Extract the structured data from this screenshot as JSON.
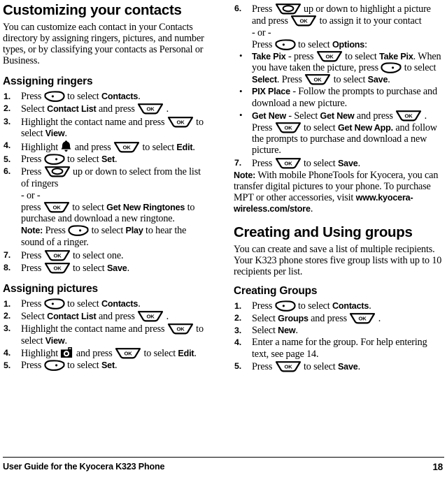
{
  "document": {
    "footer_text": "User Guide for the Kyocera K323 Phone",
    "page_number": "18"
  },
  "icons": {
    "left_softkey": "left-softkey-icon",
    "right_softkey": "right-softkey-icon",
    "ok_key": "ok-key-icon",
    "ok_key_label": "OK",
    "navigation_key": "navigation-key-icon",
    "bell": "bell-icon",
    "camera": "camera-icon"
  },
  "left_column": {
    "title": "Customizing your contacts",
    "intro": "You can customize each contact in your Contacts directory by assigning ringers, pictures, and number types, or by classifying your contacts as Personal or Business.",
    "section_ringers": {
      "heading": "Assigning ringers",
      "steps": [
        {
          "num": "1.",
          "parts": [
            "Press ",
            "[LSK]",
            " to select ",
            "Contacts",
            "."
          ]
        },
        {
          "num": "2.",
          "parts": [
            "Select ",
            "Contact List",
            " and press ",
            "[OK]",
            " ."
          ]
        },
        {
          "num": "3.",
          "parts": [
            "Highlight the contact name and press ",
            "[OK]",
            " to select ",
            "View",
            "."
          ]
        },
        {
          "num": "4.",
          "parts": [
            "Highlight ",
            "[BELL]",
            " and press ",
            "[OK]",
            " to select ",
            "Edit",
            "."
          ]
        },
        {
          "num": "5.",
          "parts": [
            "Press ",
            "[RSK]",
            " to select ",
            "Set",
            "."
          ]
        },
        {
          "num": "6.",
          "parts": [
            "Press ",
            "[NAV]",
            " up or down to select from the list of ringers"
          ]
        }
      ],
      "step6_or": "- or -",
      "step6_alt": [
        "press ",
        "[OK]",
        " to select ",
        "Get New Ringtones",
        " to purchase and download a new ringtone."
      ],
      "note": {
        "label": "Note:",
        "parts": [
          "  Press ",
          "[RSK]",
          " to select ",
          "Play",
          " to hear the sound of a ringer."
        ]
      },
      "steps_cont": [
        {
          "num": "7.",
          "parts": [
            "Press ",
            "[OK]",
            " to select one."
          ]
        },
        {
          "num": "8.",
          "parts": [
            "Press ",
            "[OK]",
            " to select ",
            "Save",
            "."
          ]
        }
      ]
    },
    "section_pictures": {
      "heading": "Assigning pictures",
      "steps": [
        {
          "num": "1.",
          "parts": [
            "Press ",
            "[LSK]",
            " to select ",
            "Contacts",
            "."
          ]
        },
        {
          "num": "2.",
          "parts": [
            "Select ",
            "Contact List",
            " and press ",
            "[OK]",
            " ."
          ]
        },
        {
          "num": "3.",
          "parts": [
            "Highlight the contact name and press ",
            "[OK]",
            " to select ",
            "View",
            "."
          ]
        },
        {
          "num": "4.",
          "parts": [
            "Highlight ",
            "[CAM]",
            " and press ",
            "[OK]",
            " to select ",
            "Edit",
            "."
          ]
        },
        {
          "num": "5.",
          "parts": [
            "Press ",
            "[RSK]",
            " to select ",
            "Set",
            "."
          ]
        }
      ]
    }
  },
  "right_column": {
    "step6": {
      "num": "6.",
      "line1": [
        "Press ",
        "[NAV]",
        " up or down to highlight a picture and press ",
        "[OK]",
        " to assign it to your contact"
      ],
      "or": "- or -",
      "line2": [
        "Press ",
        "[LSK]",
        " to select ",
        "Options",
        ":"
      ]
    },
    "bullets": [
      {
        "bullet": "•",
        "term": "Take Pix",
        "parts": [
          " - press ",
          "[OK]",
          " to select ",
          "Take Pix",
          ". When you have taken the picture, press ",
          "[RSK]",
          " to select ",
          "Select",
          ". Press ",
          "[OK]",
          " to select ",
          "Save",
          "."
        ]
      },
      {
        "bullet": "•",
        "term": "PIX Place",
        "parts": [
          " - Follow the prompts to purchase and download a new picture."
        ]
      },
      {
        "bullet": "•",
        "term": "Get New",
        "parts": [
          " - Select ",
          "Get New",
          " and press ",
          "[OK]",
          " . Press ",
          "[OK]",
          " to select ",
          "Get New App.",
          " and follow the prompts to purchase and download a new picture."
        ]
      }
    ],
    "step7": {
      "num": "7.",
      "parts": [
        "Press ",
        "[OK]",
        " to select ",
        "Save",
        "."
      ]
    },
    "note": {
      "label": "Note:",
      "text_before": "  With mobile PhoneTools for Kyocera, you can transfer digital pictures to your phone. To purchase MPT or other accessories, visit ",
      "url": "www.kyocera-wireless.com/store",
      "text_after": "."
    },
    "section_groups": {
      "heading": "Creating and Using groups",
      "intro": "You can create and save a list of multiple recipients. Your K323 phone stores five group lists with up to 10 recipients per list.",
      "sub_heading": "Creating Groups",
      "steps": [
        {
          "num": "1.",
          "parts": [
            "Press ",
            "[LSK]",
            " to select ",
            "Contacts",
            "."
          ]
        },
        {
          "num": "2.",
          "parts": [
            "Select ",
            "Groups",
            " and press ",
            "[OK]",
            " ."
          ]
        },
        {
          "num": "3.",
          "parts": [
            "Select ",
            "New",
            "."
          ]
        },
        {
          "num": "4.",
          "parts": [
            "Enter a name for the group. For help entering text, see page 14."
          ]
        },
        {
          "num": "5.",
          "parts": [
            "Press ",
            "[OK]",
            " to select ",
            "Save",
            "."
          ]
        }
      ]
    }
  }
}
